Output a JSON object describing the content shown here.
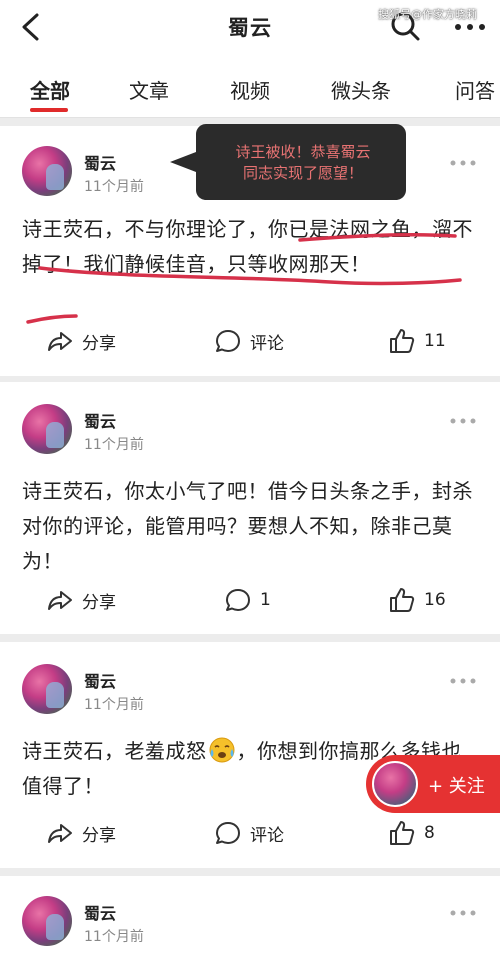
{
  "header": {
    "title": "蜀云",
    "watermark": "搜狐号@作家方晓莉"
  },
  "tabs": [
    "全部",
    "文章",
    "视频",
    "微头条",
    "问答"
  ],
  "tooltip": {
    "line1": "诗王被收！恭喜蜀云",
    "line2": "同志实现了愿望！"
  },
  "posts": [
    {
      "author": "蜀云",
      "time": "11个月前",
      "content": "诗王荧石，不与你理论了，你已是法网之鱼，溜不掉了！我们静候佳音，只等收网那天！",
      "share": "分享",
      "comment": "评论",
      "likes": "11"
    },
    {
      "author": "蜀云",
      "time": "11个月前",
      "content": "诗王荧石，你太小气了吧！借今日头条之手，封杀对你的评论，能管用吗？要想人不知，除非己莫为！",
      "share": "分享",
      "comment": "1",
      "likes": "16"
    },
    {
      "author": "蜀云",
      "time": "11个月前",
      "content_before": "诗王荧石，老羞成怒",
      "content_after": "，你想到你搞那么多钱也值得了！",
      "share": "分享",
      "comment": "评论",
      "likes": "8"
    },
    {
      "author": "蜀云",
      "time": "11个月前"
    }
  ],
  "follow": {
    "label": "+ 关注"
  },
  "colors": {
    "accent": "#e53232",
    "annotation": "#d6314a"
  }
}
